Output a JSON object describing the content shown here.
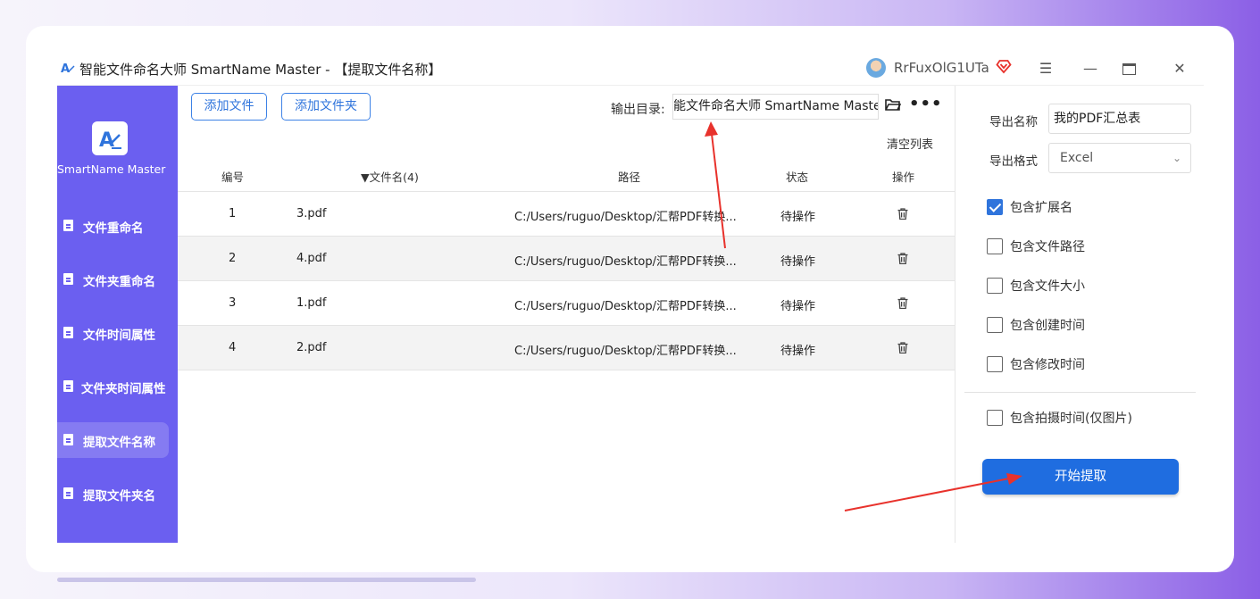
{
  "window": {
    "title": "智能文件命名大师 SmartName Master - 【提取文件名称】",
    "username": "RrFuxOlG1UTa",
    "menu_icon": "menu-icon",
    "minimize_icon": "minimize-icon",
    "maximize_icon": "maximize-icon",
    "close_icon": "close-icon"
  },
  "sidebar": {
    "logo_text": "SmartName Master",
    "items": [
      {
        "label": "文件重命名",
        "active": false
      },
      {
        "label": "文件夹重命名",
        "active": false
      },
      {
        "label": "文件时间属性",
        "active": false
      },
      {
        "label": "文件夹时间属性",
        "active": false
      },
      {
        "label": "提取文件名称",
        "active": true
      },
      {
        "label": "提取文件夹名",
        "active": false
      }
    ]
  },
  "toolbar": {
    "add_file": "添加文件",
    "add_folder": "添加文件夹",
    "output_label": "输出目录:",
    "output_path": "能文件命名大师 SmartName Master",
    "clear_list": "清空列表"
  },
  "table": {
    "headers": {
      "index": "编号",
      "filename": "▼文件名(4)",
      "path": "路径",
      "status": "状态",
      "action": "操作"
    },
    "rows": [
      {
        "index": "1",
        "name": "3.pdf",
        "path": "C:/Users/ruguo/Desktop/汇帮PDF转换...",
        "status": "待操作"
      },
      {
        "index": "2",
        "name": "4.pdf",
        "path": "C:/Users/ruguo/Desktop/汇帮PDF转换...",
        "status": "待操作"
      },
      {
        "index": "3",
        "name": "1.pdf",
        "path": "C:/Users/ruguo/Desktop/汇帮PDF转换...",
        "status": "待操作"
      },
      {
        "index": "4",
        "name": "2.pdf",
        "path": "C:/Users/ruguo/Desktop/汇帮PDF转换...",
        "status": "待操作"
      }
    ]
  },
  "panel": {
    "export_name_label": "导出名称",
    "export_name_value": "我的PDF汇总表",
    "export_format_label": "导出格式",
    "export_format_value": "Excel",
    "options": [
      {
        "label": "包含扩展名",
        "checked": true
      },
      {
        "label": "包含文件路径",
        "checked": false
      },
      {
        "label": "包含文件大小",
        "checked": false
      },
      {
        "label": "包含创建时间",
        "checked": false
      },
      {
        "label": "包含修改时间",
        "checked": false
      },
      {
        "label": "包含拍摄时间(仅图片)",
        "checked": false
      }
    ],
    "start_button": "开始提取"
  },
  "colors": {
    "sidebar": "#6b5ff0",
    "accent": "#1f6de0",
    "annotation_arrow": "#e8322c"
  }
}
